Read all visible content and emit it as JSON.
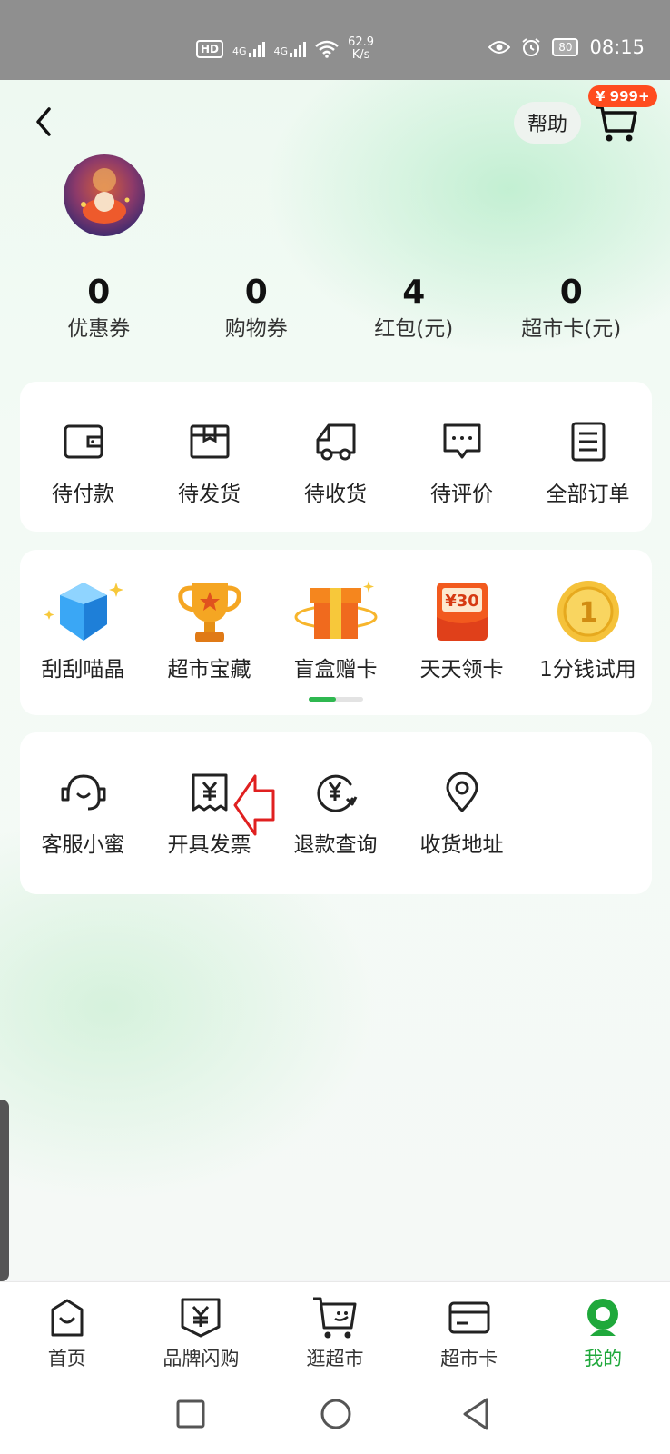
{
  "status_bar": {
    "hd": "HD",
    "signal_1": "4G",
    "signal_2": "4G",
    "speed_value": "62.9",
    "speed_unit": "K/s",
    "battery": "80",
    "time": "08:15"
  },
  "header": {
    "help_label": "帮助",
    "cart_badge": "¥ 999+"
  },
  "stats": [
    {
      "value": "0",
      "label": "优惠券"
    },
    {
      "value": "0",
      "label": "购物券"
    },
    {
      "value": "4",
      "label": "红包(元)"
    },
    {
      "value": "0",
      "label": "超市卡(元)"
    }
  ],
  "orders": [
    {
      "label": "待付款",
      "icon": "wallet-icon"
    },
    {
      "label": "待发货",
      "icon": "package-icon"
    },
    {
      "label": "待收货",
      "icon": "truck-icon"
    },
    {
      "label": "待评价",
      "icon": "comment-icon"
    },
    {
      "label": "全部订单",
      "icon": "order-list-icon"
    }
  ],
  "activities": [
    {
      "label": "刮刮喵晶",
      "icon": "crystal-icon"
    },
    {
      "label": "超市宝藏",
      "icon": "trophy-icon"
    },
    {
      "label": "盲盒赠卡",
      "icon": "gift-box-icon"
    },
    {
      "label": "天天领卡",
      "icon": "coupon-30-icon",
      "badge": "¥30"
    },
    {
      "label": "1分钱试用",
      "icon": "coin-icon",
      "badge": "1"
    }
  ],
  "services": [
    {
      "label": "客服小蜜",
      "icon": "headset-icon"
    },
    {
      "label": "开具发票",
      "icon": "invoice-icon"
    },
    {
      "label": "退款查询",
      "icon": "refund-icon"
    },
    {
      "label": "收货地址",
      "icon": "location-icon"
    }
  ],
  "tabs": [
    {
      "label": "首页",
      "icon": "home-bag-icon"
    },
    {
      "label": "品牌闪购",
      "icon": "brand-flash-icon"
    },
    {
      "label": "逛超市",
      "icon": "shopping-cart-icon"
    },
    {
      "label": "超市卡",
      "icon": "card-icon"
    },
    {
      "label": "我的",
      "icon": "profile-icon",
      "active": true
    }
  ],
  "colors": {
    "accent_green": "#1fa83b",
    "badge_orange": "#ff4c1f",
    "annotation_red": "#e02020"
  }
}
